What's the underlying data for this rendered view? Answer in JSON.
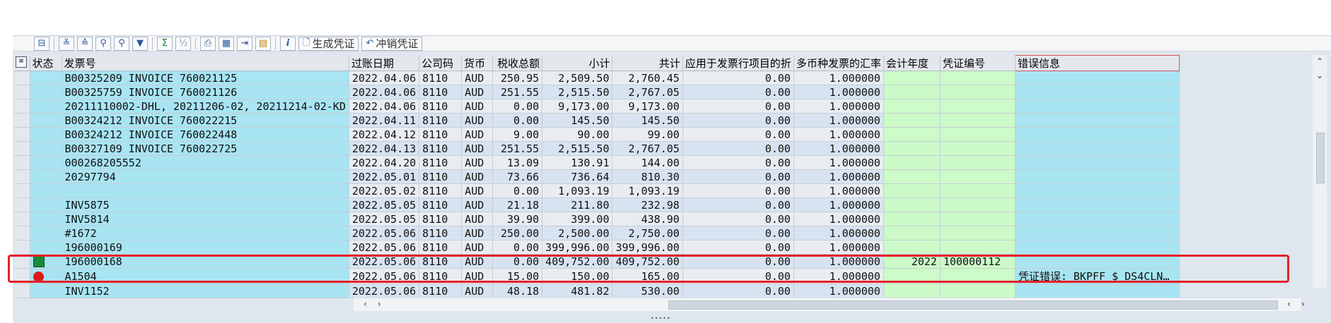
{
  "toolbar": {
    "buttons": [
      "select-detail-icon",
      "sort-ascending-icon",
      "sort-descending-icon",
      "find-icon",
      "find-next-icon",
      "filter-icon",
      "sum-icon",
      "subtotal-icon",
      "print-icon",
      "view-icon",
      "export-icon",
      "layout-icon",
      "info-icon"
    ],
    "generate_voucher": "生成凭证",
    "reverse_voucher": "冲销凭证"
  },
  "columns": [
    "状态",
    "发票号",
    "过账日期",
    "公司码",
    "货币",
    "税收总额",
    "小计",
    "共计",
    "应用于发票行项目的折",
    "多币种发票的汇率",
    "会计年度",
    "凭证编号",
    "错误信息"
  ],
  "rows": [
    {
      "status": "",
      "invoice": "B00325209 INVOICE 760021125",
      "date": "2022.04.06",
      "company": "8110",
      "currency": "AUD",
      "tax": "250.95",
      "subtotal": "2,509.50",
      "total": "2,760.45",
      "discount": "0.00",
      "rate": "1.000000",
      "year": "",
      "voucher": "",
      "error": ""
    },
    {
      "status": "",
      "invoice": "B00325759 INVOICE 760021126",
      "date": "2022.04.06",
      "company": "8110",
      "currency": "AUD",
      "tax": "251.55",
      "subtotal": "2,515.50",
      "total": "2,767.05",
      "discount": "0.00",
      "rate": "1.000000",
      "year": "",
      "voucher": "",
      "error": ""
    },
    {
      "status": "",
      "invoice": "20211110002-DHL, 20211206-02, 20211214-02-KD",
      "date": "2022.04.06",
      "company": "8110",
      "currency": "AUD",
      "tax": "0.00",
      "subtotal": "9,173.00",
      "total": "9,173.00",
      "discount": "0.00",
      "rate": "1.000000",
      "year": "",
      "voucher": "",
      "error": ""
    },
    {
      "status": "",
      "invoice": "B00324212 INVOICE 760022215",
      "date": "2022.04.11",
      "company": "8110",
      "currency": "AUD",
      "tax": "0.00",
      "subtotal": "145.50",
      "total": "145.50",
      "discount": "0.00",
      "rate": "1.000000",
      "year": "",
      "voucher": "",
      "error": ""
    },
    {
      "status": "",
      "invoice": "B00324212 INVOICE 760022448",
      "date": "2022.04.12",
      "company": "8110",
      "currency": "AUD",
      "tax": "9.00",
      "subtotal": "90.00",
      "total": "99.00",
      "discount": "0.00",
      "rate": "1.000000",
      "year": "",
      "voucher": "",
      "error": ""
    },
    {
      "status": "",
      "invoice": "B00327109 INVOICE 760022725",
      "date": "2022.04.13",
      "company": "8110",
      "currency": "AUD",
      "tax": "251.55",
      "subtotal": "2,515.50",
      "total": "2,767.05",
      "discount": "0.00",
      "rate": "1.000000",
      "year": "",
      "voucher": "",
      "error": ""
    },
    {
      "status": "",
      "invoice": "000268205552",
      "date": "2022.04.20",
      "company": "8110",
      "currency": "AUD",
      "tax": "13.09",
      "subtotal": "130.91",
      "total": "144.00",
      "discount": "0.00",
      "rate": "1.000000",
      "year": "",
      "voucher": "",
      "error": ""
    },
    {
      "status": "",
      "invoice": "20297794",
      "date": "2022.05.01",
      "company": "8110",
      "currency": "AUD",
      "tax": "73.66",
      "subtotal": "736.64",
      "total": "810.30",
      "discount": "0.00",
      "rate": "1.000000",
      "year": "",
      "voucher": "",
      "error": ""
    },
    {
      "status": "",
      "invoice": "",
      "date": "2022.05.02",
      "company": "8110",
      "currency": "AUD",
      "tax": "0.00",
      "subtotal": "1,093.19",
      "total": "1,093.19",
      "discount": "0.00",
      "rate": "1.000000",
      "year": "",
      "voucher": "",
      "error": ""
    },
    {
      "status": "",
      "invoice": "INV5875",
      "date": "2022.05.05",
      "company": "8110",
      "currency": "AUD",
      "tax": "21.18",
      "subtotal": "211.80",
      "total": "232.98",
      "discount": "0.00",
      "rate": "1.000000",
      "year": "",
      "voucher": "",
      "error": ""
    },
    {
      "status": "",
      "invoice": "INV5814",
      "date": "2022.05.05",
      "company": "8110",
      "currency": "AUD",
      "tax": "39.90",
      "subtotal": "399.00",
      "total": "438.90",
      "discount": "0.00",
      "rate": "1.000000",
      "year": "",
      "voucher": "",
      "error": ""
    },
    {
      "status": "",
      "invoice": "#1672",
      "date": "2022.05.06",
      "company": "8110",
      "currency": "AUD",
      "tax": "250.00",
      "subtotal": "2,500.00",
      "total": "2,750.00",
      "discount": "0.00",
      "rate": "1.000000",
      "year": "",
      "voucher": "",
      "error": ""
    },
    {
      "status": "",
      "invoice": "196000169",
      "date": "2022.05.06",
      "company": "8110",
      "currency": "AUD",
      "tax": "0.00",
      "subtotal": "399,996.00",
      "total": "399,996.00",
      "discount": "0.00",
      "rate": "1.000000",
      "year": "",
      "voucher": "",
      "error": ""
    },
    {
      "status": "green-square-icon",
      "invoice": "196000168",
      "date": "2022.05.06",
      "company": "8110",
      "currency": "AUD",
      "tax": "0.00",
      "subtotal": "409,752.00",
      "total": "409,752.00",
      "discount": "0.00",
      "rate": "1.000000",
      "year": "2022",
      "voucher": "100000112",
      "error": ""
    },
    {
      "status": "red-circle-icon",
      "invoice": "A1504",
      "date": "2022.05.06",
      "company": "8110",
      "currency": "AUD",
      "tax": "15.00",
      "subtotal": "150.00",
      "total": "165.00",
      "discount": "0.00",
      "rate": "1.000000",
      "year": "",
      "voucher": "",
      "error": "凭证错误: BKPFF $ DS4CLN…"
    },
    {
      "status": "",
      "invoice": "INV1152",
      "date": "2022.05.06",
      "company": "8110",
      "currency": "AUD",
      "tax": "48.18",
      "subtotal": "481.82",
      "total": "530.00",
      "discount": "0.00",
      "rate": "1.000000",
      "year": "",
      "voucher": "",
      "error": ""
    }
  ],
  "colors": {
    "highlight": "#e5202a",
    "cyan_cell": "#a8e4f2",
    "green_cell": "#ccfac8",
    "status_ok": "#1a8a3a",
    "status_error": "#dd1a1a"
  }
}
